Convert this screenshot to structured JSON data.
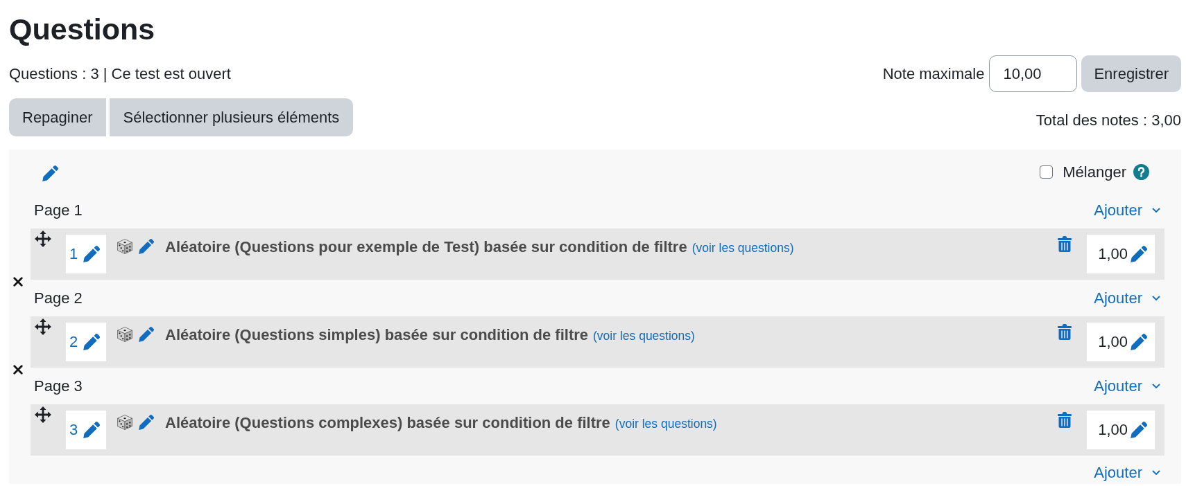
{
  "page": {
    "title": "Questions"
  },
  "status_line": "Questions : 3 | Ce test est ouvert",
  "actions": [
    "Repaginer",
    "Sélectionner plusieurs éléments"
  ],
  "max_grade": {
    "label": "Note maximale",
    "value": "10,00",
    "save_button": "Enregistrer"
  },
  "total_marks": "Total des notes : 3,00",
  "section": {
    "shuffle": {
      "label": "Mélanger",
      "checked": false
    },
    "pages": [
      {
        "label": "Page 1",
        "add_menu": "Ajouter",
        "slots": [
          {
            "number": "1",
            "title": "Aléatoire (Questions pour exemple de Test) basée sur condition de filtre",
            "view_link": "(voir les questions)",
            "mark": "1,00"
          }
        ]
      },
      {
        "label": "Page 2",
        "add_menu": "Ajouter",
        "slots": [
          {
            "number": "2",
            "title": "Aléatoire (Questions simples) basée sur condition de filtre",
            "view_link": "(voir les questions)",
            "mark": "1,00"
          }
        ]
      },
      {
        "label": "Page 3",
        "add_menu": "Ajouter",
        "slots": [
          {
            "number": "3",
            "title": "Aléatoire (Questions complexes) basée sur condition de filtre",
            "view_link": "(voir les questions)",
            "mark": "1,00"
          }
        ]
      }
    ],
    "add_menu": "Ajouter"
  }
}
